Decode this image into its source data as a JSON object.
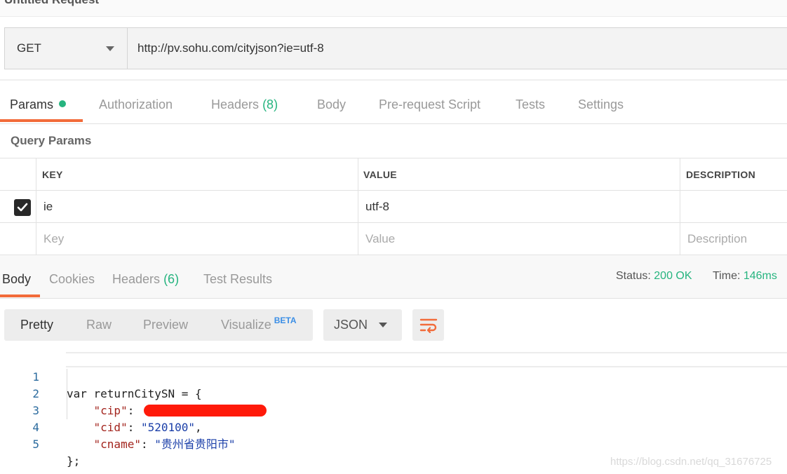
{
  "title": "Untitled Request",
  "request": {
    "method": "GET",
    "url": "http://pv.sohu.com/cityjson?ie=utf-8"
  },
  "request_tabs": [
    {
      "label": "Params",
      "count": ""
    },
    {
      "label": "Authorization",
      "count": ""
    },
    {
      "label": "Headers",
      "count": "(8)"
    },
    {
      "label": "Body",
      "count": ""
    },
    {
      "label": "Pre-request Script",
      "count": ""
    },
    {
      "label": "Tests",
      "count": ""
    },
    {
      "label": "Settings",
      "count": ""
    }
  ],
  "query_params": {
    "title": "Query Params",
    "headers": {
      "key": "KEY",
      "value": "VALUE",
      "description": "DESCRIPTION"
    },
    "rows": [
      {
        "checked": true,
        "key": "ie",
        "value": "utf-8",
        "description": ""
      }
    ],
    "placeholders": {
      "key": "Key",
      "value": "Value",
      "description": "Description"
    }
  },
  "response_tabs": [
    {
      "label": "Body",
      "count": ""
    },
    {
      "label": "Cookies",
      "count": ""
    },
    {
      "label": "Headers",
      "count": "(6)"
    },
    {
      "label": "Test Results",
      "count": ""
    }
  ],
  "status": {
    "status_label": "Status:",
    "status_value": "200 OK",
    "time_label": "Time:",
    "time_value": "146ms"
  },
  "view_modes": [
    "Pretty",
    "Raw",
    "Preview",
    "Visualize"
  ],
  "beta_label": "BETA",
  "format": "JSON",
  "code_lines": [
    {
      "num": "1",
      "text": "var returnCitySN = {"
    },
    {
      "num": "2",
      "key": "\"cip\"",
      "value": ""
    },
    {
      "num": "3",
      "key": "\"cid\"",
      "value": "\"520100\"",
      "trail": ","
    },
    {
      "num": "4",
      "key": "\"cname\"",
      "value": "\"贵州省贵阳市\""
    },
    {
      "num": "5",
      "text": "};"
    }
  ],
  "watermark": "https://blog.csdn.net/qq_31676725",
  "colors": {
    "accent": "#f26b3a",
    "success": "#26b47f",
    "redaction": "#ff1a0a"
  }
}
